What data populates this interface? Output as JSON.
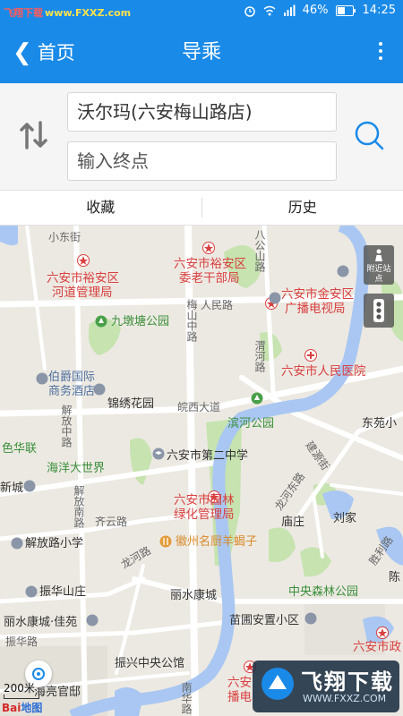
{
  "status_bar": {
    "app_watermark_1": "飞翔下载",
    "app_watermark_2": "www.FXXZ.com",
    "battery": "46%",
    "time": "14:25"
  },
  "header": {
    "back_label": "首页",
    "title": "导乘"
  },
  "route": {
    "start": "沃尔玛(六安梅山路店)",
    "end_placeholder": "输入终点"
  },
  "tabs": [
    "收藏",
    "历史"
  ],
  "map": {
    "labels": {
      "xiaodong": "小东街",
      "bashan": "八公山路",
      "yuan_office": "六安市裕安区",
      "yuan_office_2": "河道管理局",
      "yuan_party": "六安市裕安区",
      "yuan_party_2": "委老干部局",
      "jinan_radio": "六安市金安区",
      "jinan_radio_2": "广播电视局",
      "renmin_road": "人民路",
      "jiudun_park": "九墩塘公园",
      "meishan_road": "梅山中路",
      "zhaoxing": "渭河路",
      "hospital": "六安市人民医院",
      "bojue": "伯爵国际",
      "bojue_2": "商务酒店",
      "jinxiu": "锦绣花园",
      "wanxi": "皖西大道",
      "binhe_park": "滨河公园",
      "dongyuan": "东苑小",
      "jiefang_zhong": "解放中路",
      "haiyang": "海洋大世界",
      "no2_school": "六安市第二中学",
      "jiangyuan": "建源街",
      "sejilian": "色华联",
      "xincheng": "新城",
      "jiefang_nan": "解放南路",
      "qiyun": "齐云路",
      "yuanlin": "六安市园林",
      "yuanlin_2": "绿化管理局",
      "longhe_east": "龙河东路",
      "miaozhuang": "庙庄",
      "liujia": "刘家",
      "jiefang_school": "解放路小学",
      "huizhou": "徽州名厨羊蝎子",
      "longhe": "龙河路",
      "zhenhua_villa": "振华山庄",
      "lishui": "丽水康城",
      "zhongyang_park": "中央森林公园",
      "lishui_jiayuan": "丽水康城·佳苑",
      "zhenhua_road": "振华路",
      "miaopu": "苗圃安置小区",
      "zhenxing_garden": "振兴中央公馆",
      "haiting": "海亮官邸",
      "nanhua": "南华路",
      "liuan_gov": "六安市政",
      "liuan_bc": "六安",
      "liuan_bc_2": "播电",
      "shengyuan": "胜利路",
      "chen": "陈"
    },
    "controls": {
      "nearby": "附近站点",
      "scale": "200米",
      "baidu_1": "Bai",
      "baidu_2": "地图"
    },
    "watermark": {
      "text": "飞翔下载",
      "url": "WWW.FXXZ.COM"
    }
  },
  "colors": {
    "primary": "#1a8ae8",
    "river": "#a9c7f2",
    "park": "#c6e3b0",
    "road": "#ffffff",
    "map_bg": "#ece9e2"
  }
}
